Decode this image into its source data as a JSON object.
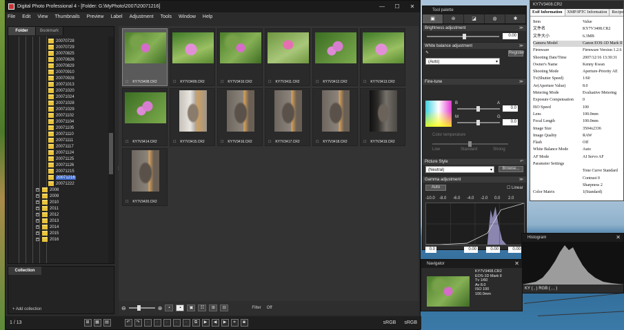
{
  "dpp": {
    "title": "Digital Photo Professional 4 - [Folder: G:\\MyPhoto\\2007\\20071216]",
    "menu": [
      "File",
      "Edit",
      "View",
      "Thumbnails",
      "Preview",
      "Label",
      "Adjustment",
      "Tools",
      "Window",
      "Help"
    ],
    "left_tabs": [
      "Folder",
      "Bookmark"
    ],
    "folders_2007": [
      "20070728",
      "20070729",
      "20070825",
      "20070826",
      "20070829",
      "20070910",
      "20070928",
      "20071013",
      "20071020",
      "20071024",
      "20071028",
      "20071029",
      "20071102",
      "20071104",
      "20071105",
      "20071110",
      "20071111",
      "20071117",
      "20071124",
      "20071125",
      "20071126",
      "20071215",
      "20071216",
      "20071222"
    ],
    "selected_folder": "20071216",
    "year_folders": [
      "2008",
      "2009",
      "2010",
      "2011",
      "2012",
      "2013",
      "2014",
      "2015",
      "2016"
    ],
    "collection_label": "Collection",
    "add_collection_label": "Add collection",
    "thumbnails": [
      {
        "name": "KY7V3408.CR2",
        "kind": "flower"
      },
      {
        "name": "KY7V3409.CR2",
        "kind": "flower2"
      },
      {
        "name": "KY7V3410.CR2",
        "kind": "flower"
      },
      {
        "name": "KY7V3411.CR2",
        "kind": "flowerbud"
      },
      {
        "name": "KY7V3412.CR2",
        "kind": "flower3"
      },
      {
        "name": "KY7V3413.CR2",
        "kind": "flower2"
      },
      {
        "name": "KY7V3414.CR2",
        "kind": "flower3"
      },
      {
        "name": "KY7V3415.CR2",
        "kind": "catlight"
      },
      {
        "name": "KY7V3416.CR2",
        "kind": "cat"
      },
      {
        "name": "KY7V3417.CR2",
        "kind": "cat"
      },
      {
        "name": "KY7V3418.CR2",
        "kind": "cat"
      },
      {
        "name": "KY7V3419.CR2",
        "kind": "catdark"
      },
      {
        "name": "KY7V3420.CR2",
        "kind": "cat"
      }
    ],
    "filter_label": "Filter",
    "filter_value": "Off",
    "page_count": "1 / 13",
    "color_space_1": "sRGB",
    "color_space_2": "sRGB"
  },
  "palette": {
    "title": "Tool palette",
    "tabs": [
      "RAW",
      "LENS",
      "CROP",
      "COLOR",
      "SETTINGS"
    ],
    "brightness_label": "Brightness adjustment",
    "brightness_value": "0.00",
    "wb_label": "White balance adjustment",
    "wb_value": "(Auto)",
    "register_label": "Register",
    "finetune_label": "Fine-tune",
    "finetune_b": "B",
    "finetune_a": "A",
    "finetune_m": "M",
    "finetune_g": "G",
    "finetune_val1": "0.0",
    "finetune_val2": "0.0",
    "wb_shift_label": "Color temperature",
    "low_label": "Low",
    "standard_label": "Standard",
    "strong_label": "Strong",
    "picture_style_label": "Picture Style",
    "picture_style_value": "(Neutral)",
    "browse_label": "Browse...",
    "gamma_label": "Gamma adjustment",
    "auto_label": "Auto",
    "linear_label": "Linear",
    "gamma_ticks": [
      "-10.0",
      "-8.0",
      "-6.0",
      "-4.0",
      "-2.0",
      "0.0",
      "2.0"
    ],
    "gamma_v1": "0.0",
    "gamma_v2": "0.00",
    "gamma_v3": "0.00",
    "gamma_v4": "0.00"
  },
  "info": {
    "title": "KY7V3408.CR2",
    "tabs": [
      "Exif Information",
      "XMP/IPTC Information",
      "Recipes"
    ],
    "rows": [
      {
        "k": "Item",
        "v": "Value"
      },
      {
        "k": "文件名",
        "v": "KY7V3408.CR2"
      },
      {
        "k": "文件大小",
        "v": "6.3MB"
      },
      {
        "k": "Camera Model",
        "v": "Canon EOS-1D Mark II"
      },
      {
        "k": "Firmware",
        "v": "Firmware Version 1.2.6"
      },
      {
        "k": "Shooting Date/Time",
        "v": "2007/12/16 13:30:31"
      },
      {
        "k": "Owner's Name",
        "v": "Kenny Kwan"
      },
      {
        "k": "Shooting Mode",
        "v": "Aperture-Priority AE"
      },
      {
        "k": "Tv(Shutter Speed)",
        "v": "1/60"
      },
      {
        "k": "Av(Aperture Value)",
        "v": "8.0"
      },
      {
        "k": "Metering Mode",
        "v": "Evaluative Metering"
      },
      {
        "k": "Exposure Compensation",
        "v": "0"
      },
      {
        "k": "ISO Speed",
        "v": "100"
      },
      {
        "k": "Lens",
        "v": "100.0mm"
      },
      {
        "k": "Focal Length",
        "v": "100.0mm"
      },
      {
        "k": "Image Size",
        "v": "3504x2336"
      },
      {
        "k": "Image Quality",
        "v": "RAW"
      },
      {
        "k": "Flash",
        "v": "Off"
      },
      {
        "k": "White Balance Mode",
        "v": "Auto"
      },
      {
        "k": "AF Mode",
        "v": "AI Servo AF"
      },
      {
        "k": "Parameter Settings",
        "v": ""
      },
      {
        "k": "",
        "v": "Tone Curve  Standard"
      },
      {
        "k": "",
        "v": "Contrast    0"
      },
      {
        "k": "",
        "v": "Sharpness  2"
      },
      {
        "k": "Color Matrix",
        "v": "1(Standard)"
      }
    ]
  },
  "histogram": {
    "title": "Histogram",
    "readout": "KY (  ,  ) RGB (  ,  ,  )"
  },
  "navigator": {
    "title": "Navigator",
    "lines": [
      "KY7V3408.CR2",
      "EOS-1D Mark II",
      "Tv 1/60",
      "Av 8.0",
      "ISO 100",
      "100.0mm"
    ]
  }
}
